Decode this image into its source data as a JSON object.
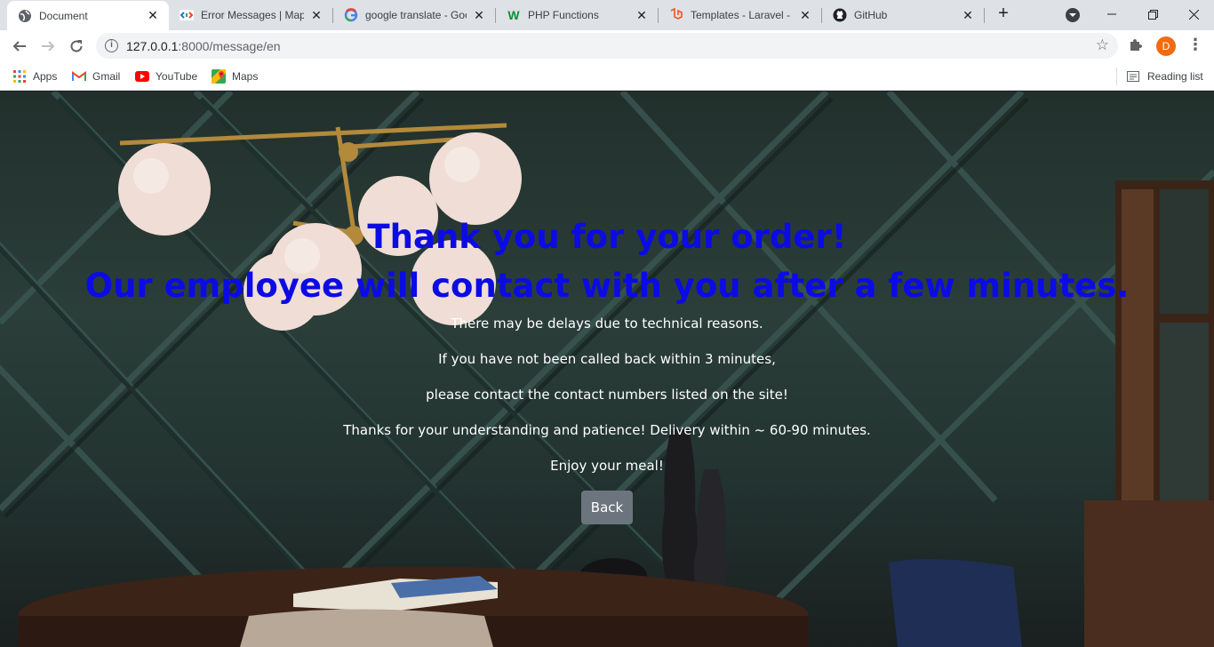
{
  "tabs": [
    {
      "title": "Document",
      "icon": "globe-icon"
    },
    {
      "title": "Error Messages | Map",
      "icon": "code-icon"
    },
    {
      "title": "google translate - Goo",
      "icon": "google-icon"
    },
    {
      "title": "PHP Functions",
      "icon": "w-icon"
    },
    {
      "title": "Templates - Laravel - T",
      "icon": "laravel-icon"
    },
    {
      "title": "GitHub",
      "icon": "github-icon"
    }
  ],
  "address_bar": {
    "host": "127.0.0.1",
    "path": ":8000/message/en"
  },
  "profile_initial": "D",
  "bookmarks": [
    {
      "label": "Apps"
    },
    {
      "label": "Gmail"
    },
    {
      "label": "YouTube"
    },
    {
      "label": "Maps"
    }
  ],
  "reading_list_label": "Reading list",
  "page": {
    "heading_line1": "Thank you for your order!",
    "heading_line2": "Our employee will contact with you after a few minutes.",
    "lines": [
      "There may be delays due to technical reasons.",
      "If you have not been called back within 3 minutes,",
      "please contact the contact numbers listed on the site!",
      "Thanks for your understanding and patience! Delivery within ~ 60-90 minutes.",
      "Enjoy your meal!"
    ],
    "back_label": "Back"
  },
  "colors": {
    "heading": "#0b0be6",
    "back_button": "#6c757d",
    "profile": "#f06b13"
  }
}
